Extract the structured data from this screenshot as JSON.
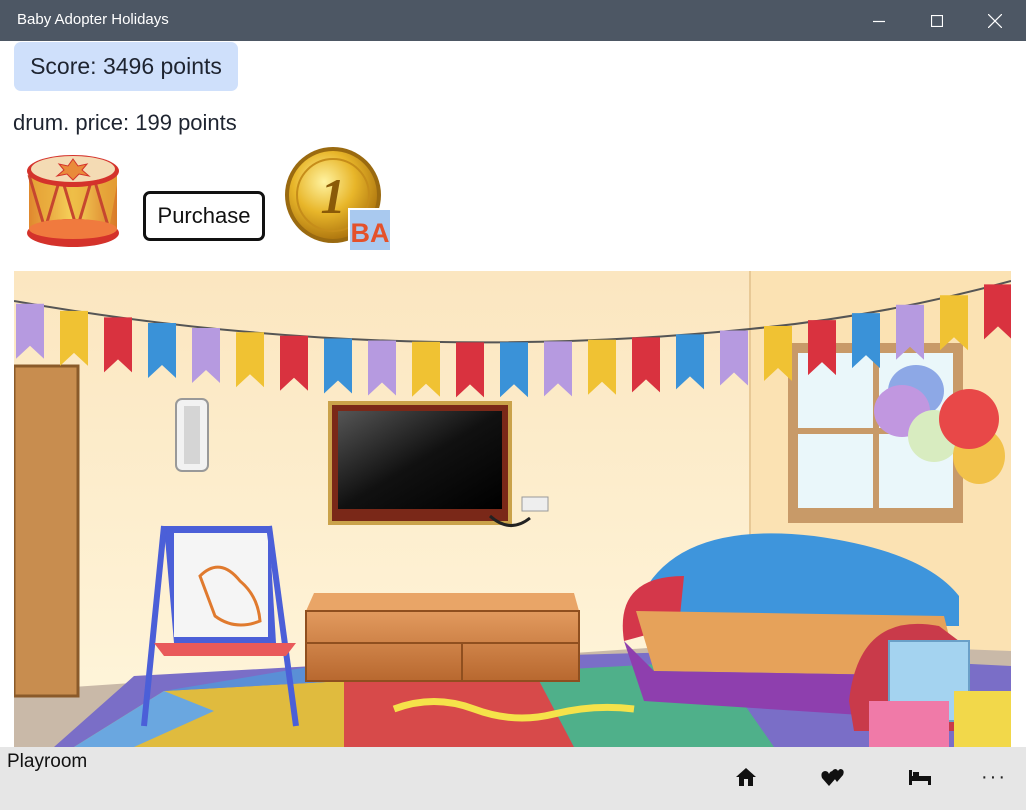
{
  "window": {
    "title": "Baby Adopter Holidays"
  },
  "score": {
    "label": "Score: 3496 points"
  },
  "item": {
    "price_label": "drum. price: 199 points",
    "icon": "drum-icon"
  },
  "purchase": {
    "label": "Purchase"
  },
  "coin": {
    "badge": "BA",
    "numeral": "1"
  },
  "appbar": {
    "page_name": "Playroom",
    "more_label": "···",
    "buttons": [
      "home-icon",
      "hearts-icon",
      "bed-icon"
    ]
  },
  "colors": {
    "titlebar": "#4d5764",
    "score_bg": "#cfe0fb",
    "appbar": "#e6e6e6"
  }
}
